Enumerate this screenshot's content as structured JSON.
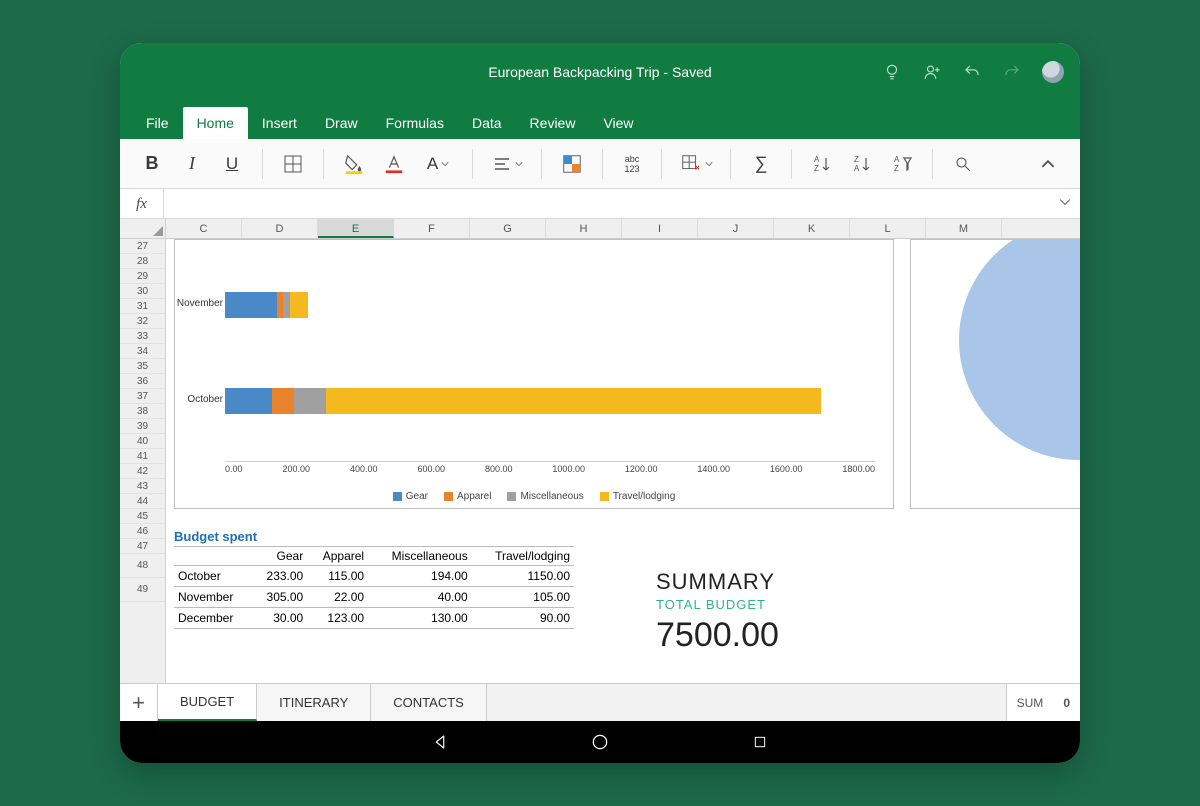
{
  "title": "European Backpacking Trip - Saved",
  "tabs": [
    "File",
    "Home",
    "Insert",
    "Draw",
    "Formulas",
    "Data",
    "Review",
    "View"
  ],
  "active_tab": "Home",
  "ribbon": {
    "abc123": "abc\n123"
  },
  "columns": [
    "C",
    "D",
    "E",
    "F",
    "G",
    "H",
    "I",
    "J",
    "K",
    "L",
    "M"
  ],
  "selected_col": "E",
  "row_start": 27,
  "row_end": 49,
  "tall_rows": [
    48,
    49
  ],
  "chart_data": {
    "type": "bar",
    "orientation": "horizontal-stacked",
    "categories": [
      "November",
      "October"
    ],
    "series": [
      {
        "name": "Gear",
        "color": "#4a89c8",
        "values": [
          145,
          130
        ]
      },
      {
        "name": "Apparel",
        "color": "#e9842c",
        "values": [
          15,
          60
        ]
      },
      {
        "name": "Miscellaneous",
        "color": "#a0a0a0",
        "values": [
          20,
          90
        ]
      },
      {
        "name": "Travel/lodging",
        "color": "#f5b920",
        "values": [
          50,
          1370
        ]
      }
    ],
    "xlim": [
      0,
      1800
    ],
    "xticks": [
      "0.00",
      "200.00",
      "400.00",
      "600.00",
      "800.00",
      "1000.00",
      "1200.00",
      "1400.00",
      "1600.00",
      "1800.00"
    ],
    "legend": [
      "Gear",
      "Apparel",
      "Miscellaneous",
      "Travel/lodging"
    ]
  },
  "budget_title": "Budget spent",
  "budget_headers": [
    "",
    "Gear",
    "Apparel",
    "Miscellaneous",
    "Travel/lodging"
  ],
  "budget_rows": [
    {
      "month": "October",
      "vals": [
        "233.00",
        "115.00",
        "194.00",
        "1150.00"
      ]
    },
    {
      "month": "November",
      "vals": [
        "305.00",
        "22.00",
        "40.00",
        "105.00"
      ]
    },
    {
      "month": "December",
      "vals": [
        "30.00",
        "123.00",
        "130.00",
        "90.00"
      ]
    }
  ],
  "summary": {
    "heading": "SUMMARY",
    "sub": "TOTAL BUDGET",
    "value": "7500.00"
  },
  "sheet_tabs": [
    "BUDGET",
    "ITINERARY",
    "CONTACTS"
  ],
  "active_sheet": "BUDGET",
  "status_sum_label": "SUM",
  "status_sum_value": "0"
}
